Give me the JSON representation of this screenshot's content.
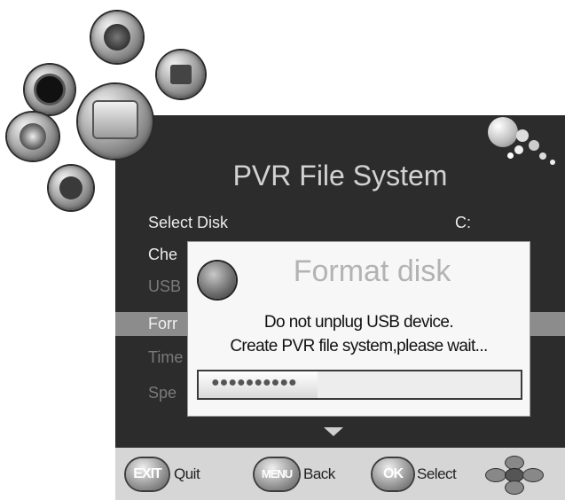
{
  "screen": {
    "title": "PVR File System",
    "menu": [
      {
        "label": "Select Disk",
        "value": "C:",
        "state": "normal"
      },
      {
        "label": "Che",
        "value": "",
        "state": "normal"
      },
      {
        "label": "USB",
        "value": "",
        "state": "disabled"
      },
      {
        "label": "Forr",
        "value": "",
        "state": "highlighted"
      },
      {
        "label": "Time",
        "value": "",
        "state": "disabled"
      },
      {
        "label": "Spe",
        "value": "",
        "state": "disabled"
      }
    ]
  },
  "dialog": {
    "title": "Format disk",
    "line1": "Do not unplug USB device.",
    "line2": "Create PVR file system,please wait...",
    "progress": 0.37,
    "progress_glyphs": "●●●●●●●●●●"
  },
  "footer": {
    "exit_key": "EXIT",
    "exit_label": "Quit",
    "menu_key": "MENU",
    "menu_label": "Back",
    "ok_key": "OK",
    "ok_label": "Select"
  },
  "icons": [
    "satellite-dish-icon",
    "installation-icon",
    "system-setup-icon",
    "tv-channel-icon",
    "media-icon",
    "lock-icon",
    "bubbles-logo-icon",
    "directional-pad-icon"
  ],
  "colors": {
    "screen_bg": "#2c2c2c",
    "highlight": "#8c8c8c",
    "dialog_bg": "#f7f7f7",
    "footer_bg": "#d6d6d6"
  }
}
